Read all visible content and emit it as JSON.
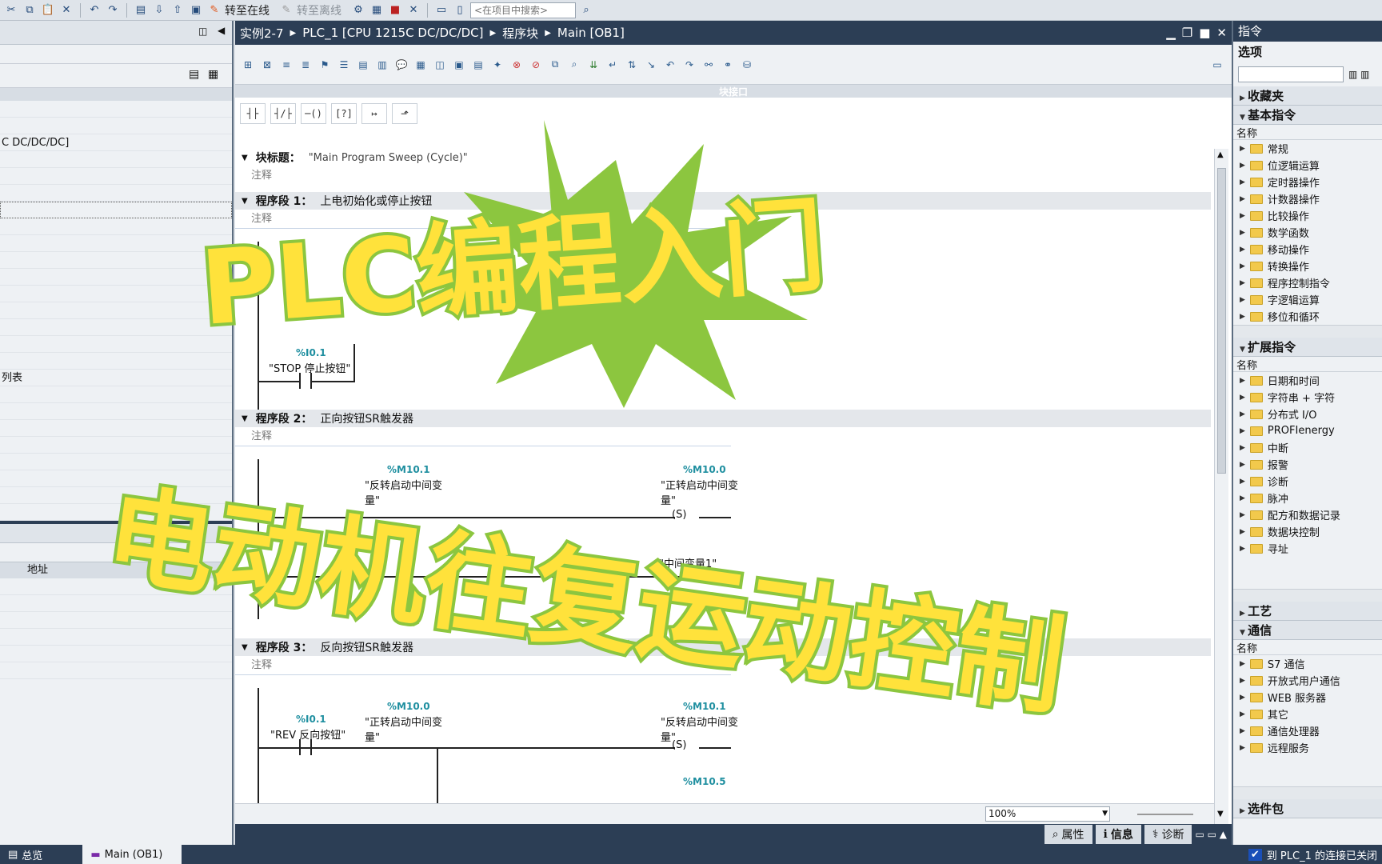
{
  "toolbar": {
    "go_online": "转至在线",
    "go_offline": "转至离线",
    "search_placeholder": "<在项目中搜索>"
  },
  "left_panel": {
    "cpu_row": "C DC/DC/DC]",
    "list_row": "列表",
    "address_col": "地址"
  },
  "editor": {
    "breadcrumb": [
      "实例2-7",
      "PLC_1 [CPU 1215C DC/DC/DC]",
      "程序块",
      "Main [OB1]"
    ],
    "block_interface": "块接口",
    "block_title_label": "块标题：",
    "block_title_value": "\"Main Program Sweep (Cycle)\"",
    "comment": "注释",
    "segments": [
      {
        "label": "程序段 1：",
        "title": "上电初始化或停止按钮"
      },
      {
        "label": "程序段 2：",
        "title": "正向按钮SR触发器"
      },
      {
        "label": "程序段 3：",
        "title": "反向按钮SR触发器"
      }
    ],
    "seg1": {
      "addr": "%I0.1",
      "tag": "\"STOP 停止按钮\""
    },
    "seg2": {
      "c1_addr": "%M10.1",
      "c1_tag": "\"反转启动中间变量\"",
      "coil_addr": "%M10.0",
      "coil_tag": "\"正转启动中间变量\"",
      "coil2_tag": "\"中间变量1\"",
      "coil_type": "S"
    },
    "seg3": {
      "c0_addr": "%I0.1",
      "c0_tag": "\"REV 反向按钮\"",
      "c1_addr": "%M10.0",
      "c1_tag": "\"正转启动中间变量\"",
      "coil_addr": "%M10.1",
      "coil_tag": "\"反转启动中间变量\"",
      "next_addr": "%M10.5",
      "coil_type": "S"
    },
    "zoom": "100%"
  },
  "right_panel": {
    "header": "指令",
    "options": "选项",
    "favorites": "收藏夹",
    "basic": "基本指令",
    "col_name": "名称",
    "basic_items": [
      "常规",
      "位逻辑运算",
      "定时器操作",
      "计数器操作",
      "比较操作",
      "数学函数",
      "移动操作",
      "转换操作",
      "程序控制指令",
      "字逻辑运算",
      "移位和循环"
    ],
    "extended": "扩展指令",
    "extended_items": [
      "日期和时间",
      "字符串 + 字符",
      "分布式 I/O",
      "PROFIenergy",
      "中断",
      "报警",
      "诊断",
      "脉冲",
      "配方和数据记录",
      "数据块控制",
      "寻址"
    ],
    "technology": "工艺",
    "comm": "通信",
    "comm_items": [
      "S7 通信",
      "开放式用户通信",
      "WEB 服务器",
      "其它",
      "通信处理器",
      "远程服务"
    ],
    "option_pkg": "选件包"
  },
  "inspector_tabs": [
    "属性",
    "信息",
    "诊断"
  ],
  "bottom": {
    "overview": "总览",
    "main_tab": "Main (OB1)",
    "status": "到 PLC_1 的连接已关闭"
  },
  "overlay": {
    "title": "PLC编程入门",
    "subtitle": "电动机往复运动控制"
  },
  "colors": {
    "overlay_fill": "#ffe23b",
    "overlay_stroke": "#8cc63f",
    "title_bar": "#2c3e55",
    "address": "#1f8fa0"
  }
}
